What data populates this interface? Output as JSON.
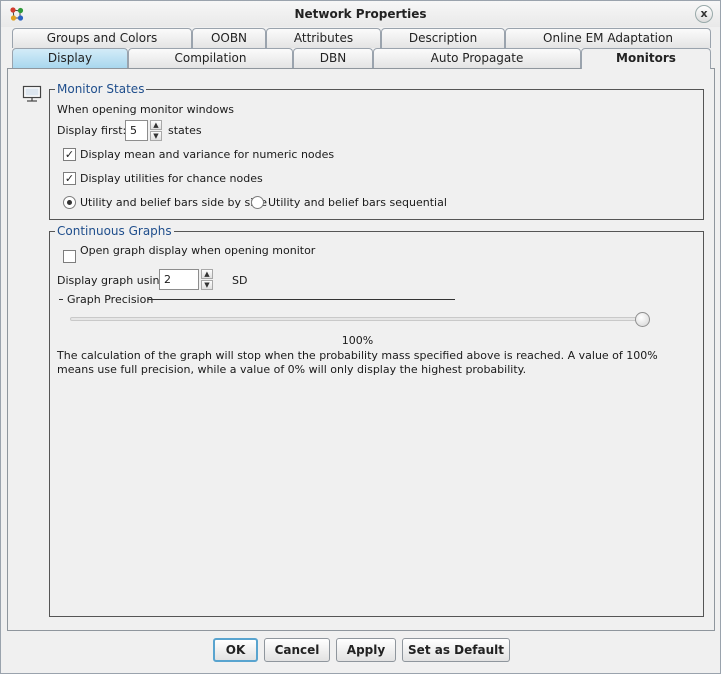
{
  "window": {
    "title": "Network Properties",
    "close_glyph": "x"
  },
  "tabs_row1": [
    "Groups and Colors",
    "OOBN",
    "Attributes",
    "Description",
    "Online EM Adaptation"
  ],
  "tabs_row2": [
    "Display",
    "Compilation",
    "DBN",
    "Auto Propagate",
    "Monitors"
  ],
  "selected_tab": "Monitors",
  "monitor_states": {
    "title": "Monitor States",
    "intro": "When opening monitor windows",
    "display_first_label": "Display first:",
    "display_first_value": "5",
    "states_label": "states",
    "mean_variance": {
      "label": "Display mean and variance for numeric nodes",
      "checked": true
    },
    "utilities_chance": {
      "label": "Display utilities for chance nodes",
      "checked": true
    },
    "bars_side_by_side": {
      "label": "Utility and belief bars side by side",
      "selected": true
    },
    "bars_sequential": {
      "label": "Utility and belief bars sequential",
      "selected": false
    }
  },
  "continuous_graphs": {
    "title": "Continuous Graphs",
    "open_graph": {
      "label": "Open graph display when opening monitor",
      "checked": false
    },
    "display_graph_label": "Display graph using:",
    "display_graph_value": "2",
    "sd_label": "SD",
    "precision_title": "Graph Precision",
    "precision_value_pct": 100,
    "precision_label": "100%",
    "description": "The calculation of the graph will stop when the probability mass specified above is reached. A value of 100% means use full precision, while a value of 0% will only display the highest probability."
  },
  "buttons": {
    "ok": "OK",
    "cancel": "Cancel",
    "apply": "Apply",
    "set_default": "Set as Default"
  },
  "icons": {
    "app": "network-nodes-icon",
    "panel": "monitor-icon",
    "spinner_up": "▲",
    "spinner_down": "▼",
    "check": "✓"
  }
}
